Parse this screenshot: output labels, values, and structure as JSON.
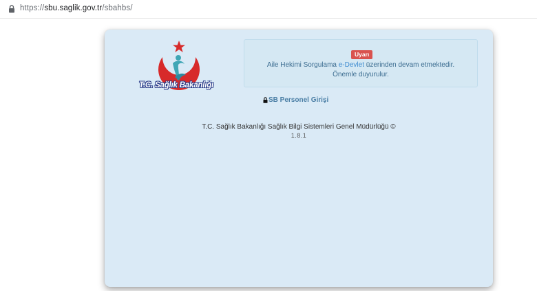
{
  "browser": {
    "url_scheme": "https://",
    "url_host": "sbu.saglik.gov.tr",
    "url_path": "/sbahbs/"
  },
  "logo": {
    "text": "T.C. Sağlık Bakanlığı"
  },
  "alert": {
    "badge": "Uyarı",
    "line1_before": "Aile Hekimi Sorgulama ",
    "line1_link": "e-Devlet",
    "line1_after": " üzerinden devam etmektedir.",
    "line2": "Önemle duyurulur."
  },
  "login": {
    "label": "SB Personel Girişi"
  },
  "footer": {
    "copyright": "T.C. Sağlık Bakanlığı Sağlık Bilgi Sistemleri Genel Müdürlüğü ©",
    "version": "1.8.1"
  },
  "colors": {
    "card_background": "#daeaf6",
    "badge": "#d9534f",
    "logo_red": "#d72a2a",
    "logo_teal": "#3fa6b5"
  }
}
